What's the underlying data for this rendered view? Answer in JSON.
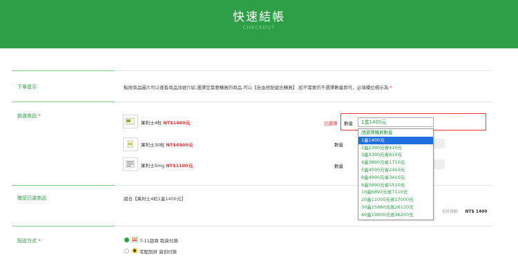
{
  "header": {
    "title": "快速結帳",
    "subtitle": "CHECKOUT"
  },
  "sections": {
    "notice": {
      "label": "下單提示",
      "text": "點按商品圖片可以查看商品詳細介紹,選擇您需要購買的商品,可以【自由搭配組合購買】,如不需要的不選擇數量即可，必填欄位標示為",
      "asterisk": "*"
    },
    "products": {
      "label": "挑選商品",
      "asterisk": "*"
    },
    "confirm": {
      "label": "確認已選商品",
      "text": "組合【果利士4粒1盒1400元】"
    },
    "shipping": {
      "label": "配送方式",
      "asterisk": "*"
    }
  },
  "products": [
    {
      "name": "果利士4粒",
      "price": "NT$1400元",
      "qty_label": "數量"
    },
    {
      "name": "果利士30粒",
      "price": "NT$4500元",
      "qty_label": "數量"
    },
    {
      "name": "果利士5mg",
      "price": "NT$1100元",
      "qty_label": "數量"
    }
  ],
  "selected_tag": "已選擇",
  "quantity_select": {
    "value": "1盒1400元",
    "options": [
      "請選擇購買數量",
      "1盒1400元",
      "2盒2390元省410元",
      "3盒3390元省810元",
      "4盒3890元省1710元",
      "5盒4590元省2410元",
      "6盒4990元省3410元",
      "8盒5690元省5510元",
      "10盒6890元省7110元",
      "20盒11000元省17000元",
      "30盒15880元省26120元",
      "40盒19800元省36200元"
    ],
    "highlighted_index": 1
  },
  "total": {
    "label": "合計總額：",
    "value": "NT$ 1400"
  },
  "shipping_options": [
    {
      "label": "7-11超商 取貨付款",
      "selected": true,
      "icon": "seven-eleven-icon"
    },
    {
      "label": "宅配到府 貨到付款",
      "selected": false,
      "icon": "delivery-icon"
    }
  ],
  "colors": {
    "brand": "#2e9e47",
    "accent_red": "#e33333",
    "highlight": "#1e6fe0"
  }
}
